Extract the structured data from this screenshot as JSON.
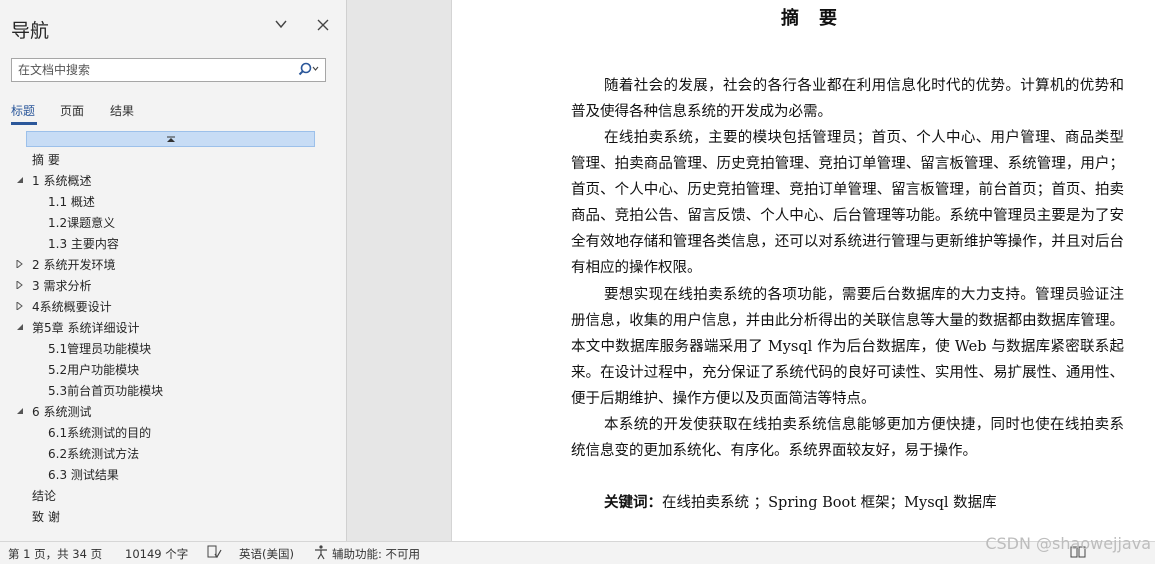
{
  "nav": {
    "title": "导航",
    "search_placeholder": "在文档中搜索",
    "tabs": [
      {
        "label": "标题",
        "active": true
      },
      {
        "label": "页面",
        "active": false
      },
      {
        "label": "结果",
        "active": false
      }
    ],
    "headings": [
      {
        "label": "摘  要",
        "level": 1,
        "expanded": null
      },
      {
        "label": "1 系统概述",
        "level": 1,
        "expanded": true
      },
      {
        "label": "1.1 概述",
        "level": 2,
        "expanded": null
      },
      {
        "label": "1.2课题意义",
        "level": 2,
        "expanded": null
      },
      {
        "label": "1.3 主要内容",
        "level": 2,
        "expanded": null
      },
      {
        "label": "2 系统开发环境",
        "level": 1,
        "expanded": false
      },
      {
        "label": "3 需求分析",
        "level": 1,
        "expanded": false
      },
      {
        "label": "4系统概要设计",
        "level": 1,
        "expanded": false
      },
      {
        "label": "第5章 系统详细设计",
        "level": 1,
        "expanded": true
      },
      {
        "label": "5.1管理员功能模块",
        "level": 2,
        "expanded": null
      },
      {
        "label": "5.2用户功能模块",
        "level": 2,
        "expanded": null
      },
      {
        "label": "5.3前台首页功能模块",
        "level": 2,
        "expanded": null
      },
      {
        "label": "6 系统测试",
        "level": 1,
        "expanded": true
      },
      {
        "label": "6.1系统测试的目的",
        "level": 2,
        "expanded": null
      },
      {
        "label": "6.2系统测试方法",
        "level": 2,
        "expanded": null
      },
      {
        "label": "6.3 测试结果",
        "level": 2,
        "expanded": null
      },
      {
        "label": "结论",
        "level": 1,
        "expanded": null
      },
      {
        "label": "致 谢",
        "level": 1,
        "expanded": null
      }
    ]
  },
  "document": {
    "title": "摘要",
    "paragraphs": [
      "随着社会的发展，社会的各行各业都在利用信息化时代的优势。计算机的优势和普及使得各种信息系统的开发成为必需。",
      "在线拍卖系统，主要的模块包括管理员；首页、个人中心、用户管理、商品类型管理、拍卖商品管理、历史竞拍管理、竞拍订单管理、留言板管理、系统管理，用户；首页、个人中心、历史竞拍管理、竞拍订单管理、留言板管理，前台首页；首页、拍卖商品、竞拍公告、留言反馈、个人中心、后台管理等功能。系统中管理员主要是为了安全有效地存储和管理各类信息，还可以对系统进行管理与更新维护等操作，并且对后台有相应的操作权限。",
      "要想实现在线拍卖系统的各项功能，需要后台数据库的大力支持。管理员验证注册信息，收集的用户信息，并由此分析得出的关联信息等大量的数据都由数据库管理。本文中数据库服务器端采用了 Mysql 作为后台数据库，使 Web 与数据库紧密联系起来。在设计过程中，充分保证了系统代码的良好可读性、实用性、易扩展性、通用性、便于后期维护、操作方便以及页面简洁等特点。",
      "本系统的开发使获取在线拍卖系统信息能够更加方便快捷，同时也使在线拍卖系统信息变的更加系统化、有序化。系统界面较友好，易于操作。"
    ],
    "keywords_label": "关键词：",
    "keywords_text": "在线拍卖系统  ；Spring  Boot 框架；Mysql 数据库"
  },
  "status": {
    "page": "第 1 页，共 34 页",
    "words": "10149 个字",
    "language": "英语(美国)",
    "accessibility": "辅助功能: 不可用"
  },
  "watermark": "CSDN @shaowejjava",
  "colors": {
    "accent": "#2b579a",
    "nav_bg": "#f3f3f3",
    "collapse_bar": "#c7dcf5"
  }
}
